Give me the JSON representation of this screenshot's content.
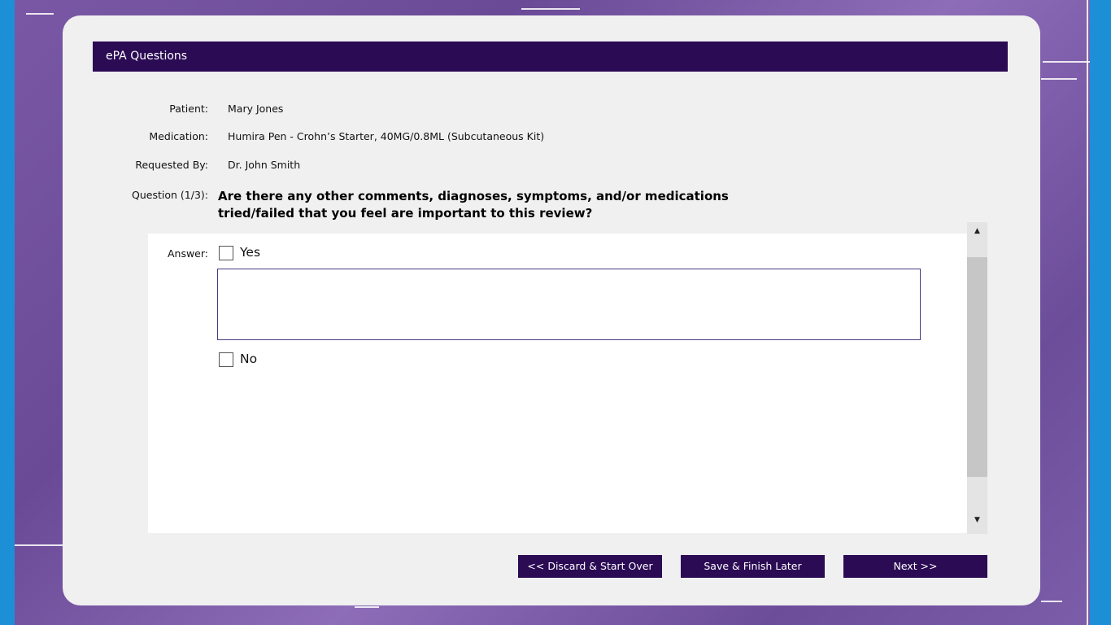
{
  "window": {
    "title": "ePA Questions"
  },
  "details": {
    "patient_label": "Patient:",
    "patient_value": "Mary Jones",
    "medication_label": "Medication:",
    "medication_value": "Humira Pen - Crohn’s Starter, 40MG/0.8ML (Subcutaneous Kit)",
    "requested_by_label": "Requested By:",
    "requested_by_value": "Dr. John Smith",
    "question_label": "Question (1/3):",
    "question_text": "Are there any other comments, diagnoses, symptoms, and/or medications tried/failed that you feel are important to this review?"
  },
  "answer": {
    "label": "Answer:",
    "yes_label": "Yes",
    "yes_checked": false,
    "comment_value": "",
    "no_label": "No",
    "no_checked": false
  },
  "scrollbar": {
    "up_glyph": "▲",
    "down_glyph": "▼"
  },
  "buttons": {
    "discard_label": "<< Discard & Start Over",
    "save_label": "Save & Finish Later",
    "next_label": "Next >>"
  },
  "colors": {
    "header_bg": "#2b0b54",
    "button_bg": "#2b0b54",
    "edge_blue": "#1d8fd6",
    "background_purple": "#7a58a6"
  }
}
